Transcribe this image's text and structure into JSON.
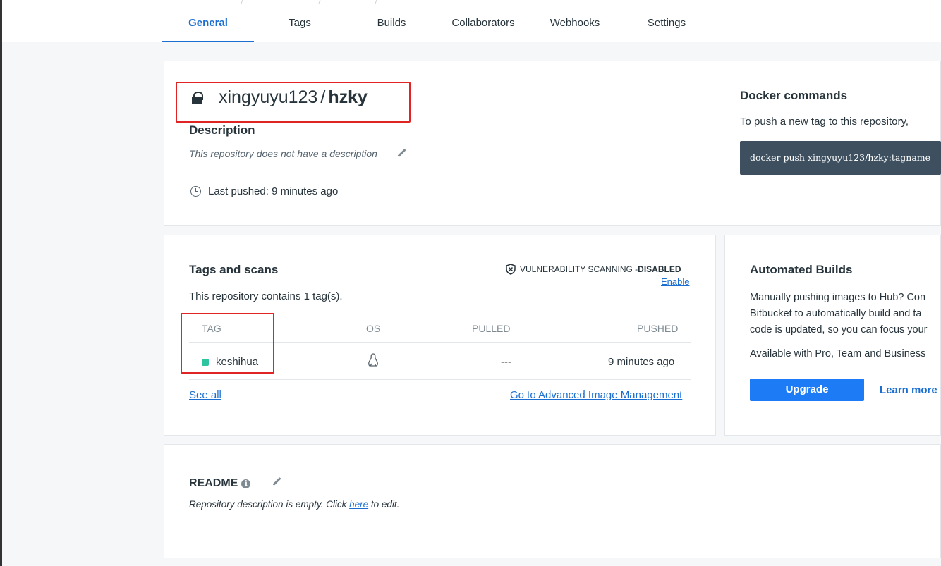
{
  "tabs": [
    {
      "label": "General"
    },
    {
      "label": "Tags"
    },
    {
      "label": "Builds"
    },
    {
      "label": "Collaborators"
    },
    {
      "label": "Webhooks"
    },
    {
      "label": "Settings"
    }
  ],
  "repo": {
    "namespace": "xingyuyu123",
    "separator": "/",
    "name": "hzky",
    "description_heading": "Description",
    "description": "This repository does not have a description",
    "last_pushed": "Last pushed: 9 minutes ago"
  },
  "docker_commands": {
    "title": "Docker commands",
    "text": "To push a new tag to this repository,",
    "command": "docker push xingyuyu123/hzky:tagname"
  },
  "tags_scans": {
    "title": "Tags and scans",
    "vuln_label": "VULNERABILITY SCANNING - ",
    "vuln_status": "DISABLED",
    "enable": "Enable",
    "contains": "This repository contains 1 tag(s).",
    "columns": [
      "TAG",
      "OS",
      "PULLED",
      "PUSHED"
    ],
    "rows": [
      {
        "tag": "keshihua",
        "os": "linux-icon",
        "pulled": "---",
        "pushed": "9 minutes ago",
        "status_color": "#2ec4a0"
      }
    ],
    "see_all": "See all",
    "advanced": "Go to Advanced Image Management"
  },
  "automated_builds": {
    "title": "Automated Builds",
    "lines": [
      "Manually pushing images to Hub? Con",
      "Bitbucket to automatically build and ta",
      "code is updated, so you can focus your"
    ],
    "available": "Available with Pro, Team and Business",
    "upgrade": "Upgrade",
    "learn_more": "Learn more"
  },
  "readme": {
    "title": "README",
    "text_before": "Repository description is empty. Click ",
    "link": "here",
    "text_after": " to edit."
  },
  "colors": {
    "accent": "#1c6fd1",
    "highlight_box": "#e02424",
    "command_bg": "#3e5060"
  }
}
